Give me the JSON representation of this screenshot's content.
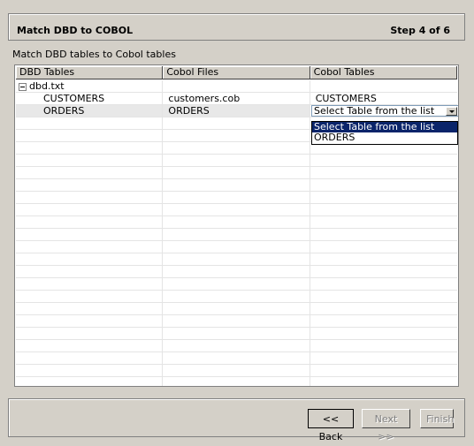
{
  "header": {
    "title": "Match DBD to COBOL",
    "step": "Step 4 of 6"
  },
  "subtitle": "Match DBD tables to Cobol tables",
  "table": {
    "columns": [
      "DBD Tables",
      "Cobol Files",
      "Cobol Tables"
    ],
    "rows": [
      {
        "dbd": "dbd.txt",
        "cobol_file": "",
        "cobol_table": ""
      },
      {
        "dbd": "CUSTOMERS",
        "cobol_file": "customers.cob",
        "cobol_table": "CUSTOMERS"
      },
      {
        "dbd": "ORDERS",
        "cobol_file": "ORDERS",
        "cobol_table": "Select Table from the list"
      }
    ]
  },
  "dropdown": {
    "options": [
      "Select Table from the list",
      "ORDERS"
    ]
  },
  "footer": {
    "back": "<< Back",
    "next": "Next >>",
    "finish": "Finish"
  }
}
